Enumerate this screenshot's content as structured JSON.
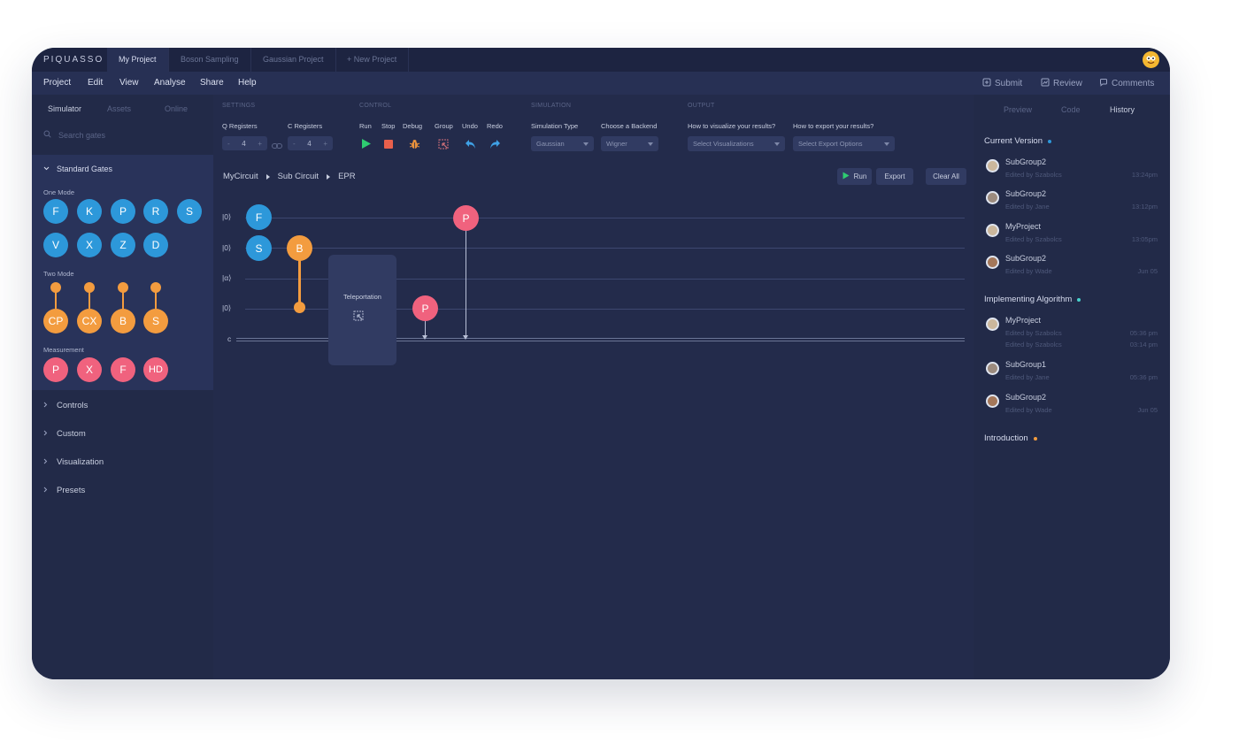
{
  "app": {
    "logo": "PIQUASSO"
  },
  "project_tabs": [
    "My Project",
    "Boson Sampling",
    "Gaussian Project",
    "+ New Project"
  ],
  "menu": [
    "Project",
    "Edit",
    "View",
    "Analyse",
    "Share",
    "Help"
  ],
  "right_menu": {
    "submit": "Submit",
    "review": "Review",
    "comments": "Comments"
  },
  "sidebar": {
    "tabs": [
      "Simulator",
      "Assets",
      "Online"
    ],
    "search_placeholder": "Search gates",
    "standard_gates": "Standard Gates",
    "one_mode_label": "One Mode",
    "one_mode": [
      "F",
      "K",
      "P",
      "R",
      "S",
      "V",
      "X",
      "Z",
      "D"
    ],
    "two_mode_label": "Two Mode",
    "two_mode": [
      "CP",
      "CX",
      "B",
      "S"
    ],
    "measurement_label": "Measurement",
    "measurement": [
      "P",
      "X",
      "F",
      "HD"
    ],
    "sections": [
      "Controls",
      "Custom",
      "Visualization",
      "Presets"
    ]
  },
  "toolbar": {
    "settings_title": "SETTINGS",
    "q_registers_label": "Q Registers",
    "q_registers": "4",
    "c_registers_label": "C Registers",
    "c_registers": "4",
    "minus": "-",
    "plus": "+",
    "control_title": "CONTROL",
    "controls": [
      "Run",
      "Stop",
      "Debug",
      "Group",
      "Undo",
      "Redo"
    ],
    "simulation_title": "SIMULATION",
    "sim_type_label": "Simulation Type",
    "sim_type": "Gaussian",
    "backend_label": "Choose a Backend",
    "backend": "Wigner",
    "output_title": "OUTPUT",
    "visualize_label": "How to visualize your results?",
    "visualize": "Select Visualizations",
    "export_label": "How to export your results?",
    "export": "Select Export Options"
  },
  "breadcrumb": [
    "MyCircuit",
    "Sub Circuit",
    "EPR"
  ],
  "actions": {
    "run": "Run",
    "export": "Export",
    "clear": "Clear All"
  },
  "circuit": {
    "wire_labels": [
      "|0⟩",
      "|0⟩",
      "|α⟩",
      "|0⟩",
      "c"
    ],
    "gates": {
      "f": "F",
      "s": "S",
      "b": "B",
      "p_top": "P",
      "p_bottom": "P"
    },
    "teleport_label": "Teleportation"
  },
  "right_panel": {
    "tabs": [
      "Preview",
      "Code",
      "History"
    ],
    "current_version": "Current Version",
    "current_items": [
      {
        "name": "SubGroup2",
        "sub": "Edited by Szabolcs",
        "time": "13:24pm"
      },
      {
        "name": "SubGroup2",
        "sub": "Edited by Jane",
        "time": "13:12pm"
      },
      {
        "name": "MyProject",
        "sub": "Edited by Szabolcs",
        "time": "13:05pm"
      },
      {
        "name": "SubGroup2",
        "sub": "Edited by Wade",
        "time": "Jun 05"
      }
    ],
    "implementing": "Implementing Algorithm",
    "impl_items": [
      {
        "name": "MyProject",
        "sub": "Edited by Szabolcs",
        "time": "05:36 pm",
        "sub2": "Edited by Szabolcs",
        "time2": "03:14 pm"
      },
      {
        "name": "SubGroup1",
        "sub": "Edited by Jane",
        "time": "05:36 pm"
      },
      {
        "name": "SubGroup2",
        "sub": "Edited by Wade",
        "time": "Jun 05"
      }
    ],
    "introduction": "Introduction"
  },
  "colors": {
    "bg": "#232b4b",
    "blue": "#2d98da",
    "orange": "#f39c3f",
    "pink": "#f0627e",
    "green": "#2ecc71"
  }
}
